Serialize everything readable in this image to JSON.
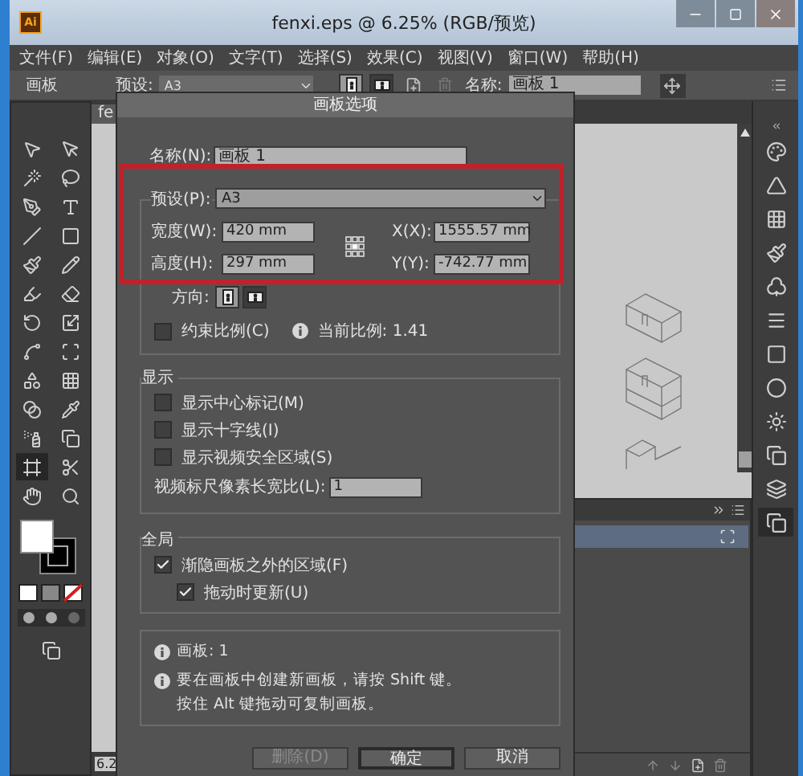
{
  "window": {
    "app_badge": "Ai",
    "title": "fenxi.eps @ 6.25% (RGB/预览)"
  },
  "menu": [
    "文件(F)",
    "编辑(E)",
    "对象(O)",
    "文字(T)",
    "选择(S)",
    "效果(C)",
    "视图(V)",
    "窗口(W)",
    "帮助(H)"
  ],
  "control_bar": {
    "label": "画板",
    "preset_label": "预设:",
    "preset_value": "A3",
    "orientation": [
      {
        "selected": true
      },
      {
        "selected": false
      }
    ],
    "name_label": "名称:",
    "name_value": "画板 1"
  },
  "document_tab": "fe",
  "zoom_field": "6.2",
  "dialog": {
    "title": "画板选项",
    "name": {
      "label": "名称(N):",
      "value": "画板 1"
    },
    "preset": {
      "label": "预设(P):",
      "value": "A3"
    },
    "width": {
      "label": "宽度(W):",
      "value": "420 mm"
    },
    "height": {
      "label": "高度(H):",
      "value": "297 mm"
    },
    "x": {
      "label": "X(X):",
      "value": "1555.57 mm"
    },
    "y": {
      "label": "Y(Y):",
      "value": "-742.77 mm"
    },
    "orientation": {
      "label": "方向:",
      "options": [
        {
          "selected": true
        },
        {
          "selected": false
        }
      ]
    },
    "constrain": {
      "label": "约束比例(C)",
      "checked": false
    },
    "ratio": "当前比例: 1.41",
    "display": {
      "title": "显示",
      "checkboxes": [
        {
          "label": "显示中心标记(M)",
          "checked": false
        },
        {
          "label": "显示十字线(I)",
          "checked": false
        },
        {
          "label": "显示视频安全区域(S)",
          "checked": false
        }
      ],
      "pixel_ratio_label": "视频标尺像素长宽比(L):",
      "pixel_ratio_value": "1"
    },
    "global": {
      "title": "全局",
      "checkboxes": [
        {
          "label": "渐隐画板之外的区域(F)",
          "checked": true,
          "children": [
            {
              "label": "拖动时更新(U)",
              "checked": true
            }
          ]
        }
      ]
    },
    "info": [
      {
        "text": "画板: 1",
        "icon": true
      },
      {
        "text": "要在画板中创建新画板，请按 Shift 键。",
        "icon": true
      },
      {
        "text": "按住 Alt 键拖动可复制画板。",
        "icon": false
      }
    ],
    "buttons": [
      {
        "label": "删除(D)",
        "disabled": true,
        "default": false
      },
      {
        "label": "确定",
        "disabled": false,
        "default": true
      },
      {
        "label": "取消",
        "disabled": false,
        "default": false
      }
    ]
  }
}
